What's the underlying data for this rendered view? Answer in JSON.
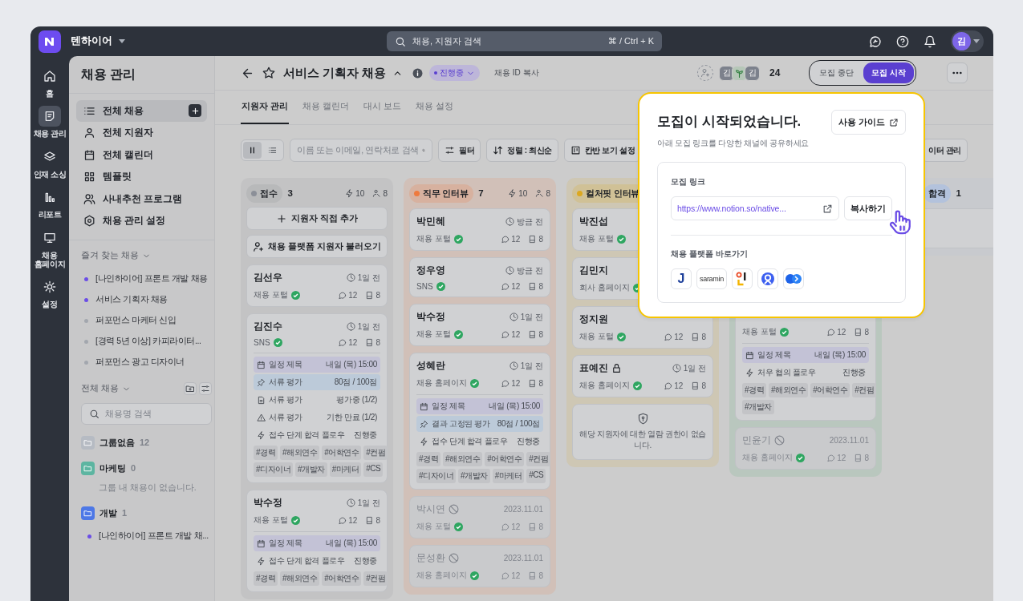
{
  "topbar": {
    "workspace": "텐하이어",
    "search": {
      "placeholder": "채용, 지원자 검색",
      "shortcut": "⌘ / Ctrl + K"
    },
    "avatar": "김"
  },
  "rail": [
    {
      "kind": "home",
      "label": "홈",
      "selected": false
    },
    {
      "kind": "recruit",
      "label": "채용 관리",
      "selected": true
    },
    {
      "kind": "layers",
      "label": "인재 소싱",
      "selected": false
    },
    {
      "kind": "report",
      "label": "리포트",
      "selected": false
    },
    {
      "kind": "monitor",
      "label": "채용 홈페이지",
      "selected": false
    },
    {
      "kind": "gear",
      "label": "설정",
      "selected": false
    }
  ],
  "sidebar": {
    "title": "채용 관리",
    "nav": [
      {
        "kind": "list",
        "label": "전체 채용",
        "selected": true,
        "add": true
      },
      {
        "kind": "user",
        "label": "전체 지원자",
        "selected": false,
        "add": false
      },
      {
        "kind": "calendar",
        "label": "전체 캘린더",
        "selected": false,
        "add": false
      },
      {
        "kind": "grid",
        "label": "템플릿",
        "selected": false,
        "add": false
      },
      {
        "kind": "users",
        "label": "사내추천 프로그램",
        "selected": false,
        "add": false
      },
      {
        "kind": "hexagon",
        "label": "채용 관리 설정",
        "selected": false,
        "add": false
      }
    ],
    "favorites": {
      "title": "즐겨 찾는 채용",
      "items": [
        {
          "label": "[나인하이어] 프론트 개발 채용",
          "color": "#6b4ee6"
        },
        {
          "label": "서비스 기획자 채용",
          "color": "#6b4ee6"
        },
        {
          "label": "퍼포먼스 마케터 신입",
          "color": "#a3a7ae"
        },
        {
          "label": "[경력 5년 이상] 카피라이터...",
          "color": "#a3a7ae"
        },
        {
          "label": "퍼포먼스 광고 디자이너",
          "color": "#a3a7ae"
        }
      ]
    },
    "all": {
      "title": "전체 채용",
      "search_placeholder": "채용명 검색",
      "groups": [
        {
          "name": "그룹없음",
          "count": "12",
          "color": "#b6bbc3"
        },
        {
          "name": "마케팅",
          "count": "0",
          "color": "#5db5a1",
          "empty_text": "그룹 내 채용이 없습니다."
        },
        {
          "name": "개발",
          "count": "1",
          "color": "#4d78e6",
          "items": [
            {
              "label": "[나인하이어] 프론트 개발 채...",
              "color": "#6b4ee6"
            }
          ]
        }
      ]
    }
  },
  "header": {
    "title": "서비스 기획자 채용",
    "status": "진행중",
    "copy_id": "채용 ID 복사",
    "members": [
      {
        "kind": "initial",
        "text": "김"
      },
      {
        "kind": "leaf"
      },
      {
        "kind": "initial",
        "text": "김"
      }
    ],
    "member_count": "24",
    "toggle": [
      {
        "label": "모집 중단",
        "selected": false
      },
      {
        "label": "모집 시작",
        "selected": true
      }
    ]
  },
  "tabs": [
    {
      "label": "지원자 관리",
      "selected": true
    },
    {
      "label": "채용 캘린더",
      "selected": false
    },
    {
      "label": "대시 보드",
      "selected": false
    },
    {
      "label": "채용 설정",
      "selected": false
    }
  ],
  "toolbar": {
    "views": [
      {
        "kind": "kanban",
        "selected": true
      },
      {
        "kind": "list",
        "selected": false
      }
    ],
    "search_placeholder": "이름 또는 이메일, 연락처로 검색",
    "buttons": [
      {
        "kind": "filter",
        "label": "필터"
      },
      {
        "kind": "sort",
        "label": "정렬 : 최신순"
      },
      {
        "kind": "board",
        "label": "칸반 보기 설정"
      }
    ],
    "data_button": "이터 관리"
  },
  "board": {
    "columns": [
      {
        "label": "접수",
        "color": "#8b8f98",
        "covered": false,
        "count": "3",
        "flows": "10",
        "people": "8",
        "actions": [
          {
            "kind": "add",
            "label": "지원자 직접 추가"
          },
          {
            "kind": "import",
            "label": "채용 플랫폼 지원자 불러오기"
          }
        ],
        "cards": [
          {
            "kind": "normal",
            "name": "김선우",
            "time": "1일 전",
            "source": "채용 포털",
            "verified": true,
            "comments": "12",
            "docs": "8"
          },
          {
            "kind": "normal",
            "name": "김진수",
            "time": "1일 전",
            "source": "SNS",
            "verified": true,
            "comments": "12",
            "docs": "8",
            "rows": [
              {
                "kind": "schedule",
                "label": "일정 제목",
                "value": "내일 (목) 15:00"
              },
              {
                "kind": "score",
                "label": "서류 평가",
                "value": "80점 / 100점"
              },
              {
                "kind": "doc",
                "label": "서류 평가",
                "value": "평가중 (1/2)"
              },
              {
                "kind": "warning",
                "label": "서류 평가",
                "value": "기한 만료 (1/2)"
              },
              {
                "kind": "flow",
                "label": "접수 단계 합격 플로우",
                "value": "진행중"
              }
            ],
            "tags": [
              "#경력",
              "#해외연수",
              "#어학연수",
              "#컨펌",
              "#디자이너",
              "#개발자",
              "#마케터",
              "#CS"
            ]
          },
          {
            "kind": "normal",
            "name": "박수정",
            "time": "1일 전",
            "source": "채용 포털",
            "verified": true,
            "comments": "12",
            "docs": "8",
            "rows": [
              {
                "kind": "schedule",
                "label": "일정 제목",
                "value": "내일 (목) 15:00"
              },
              {
                "kind": "flow",
                "label": "접수 단계 합격 플로우",
                "value": "진행중"
              }
            ],
            "tags": [
              "#경력",
              "#해외연수",
              "#어학연수",
              "#컨펌"
            ]
          }
        ]
      },
      {
        "label": "직무 인터뷰",
        "color": "#ee7a3e",
        "covered": false,
        "count": "7",
        "flows": "10",
        "people": "8",
        "cards": [
          {
            "kind": "normal",
            "name": "박민혜",
            "time": "방금 전",
            "source": "채용 포털",
            "verified": true,
            "comments": "12",
            "docs": "8"
          },
          {
            "kind": "normal",
            "name": "정우영",
            "time": "방금 전",
            "source": "SNS",
            "verified": true,
            "comments": "12",
            "docs": "8"
          },
          {
            "kind": "normal",
            "name": "박수정",
            "time": "1일 전",
            "source": "채용 포털",
            "verified": true,
            "comments": "12",
            "docs": "8"
          },
          {
            "kind": "normal",
            "name": "성혜란",
            "time": "1일 전",
            "source": "채용 홈페이지",
            "verified": true,
            "comments": "12",
            "docs": "8",
            "rows": [
              {
                "kind": "schedule",
                "label": "일정 제목",
                "value": "내일 (목) 15:00"
              },
              {
                "kind": "score",
                "label": "결과 고정된 평가",
                "value": "80점 / 100점"
              },
              {
                "kind": "flow",
                "label": "접수 단계 합격 플로우",
                "value": "진행중"
              }
            ],
            "tags": [
              "#경력",
              "#해외연수",
              "#어학연수",
              "#컨펌",
              "#디자이너",
              "#개발자",
              "#마케터",
              "#CS"
            ]
          },
          {
            "kind": "disabled",
            "name": "박시연",
            "date": "2023.11.01",
            "source": "채용 포털",
            "verified": true,
            "comments": "12",
            "docs": "8"
          },
          {
            "kind": "disabled",
            "name": "문성환",
            "date": "2023.11.01",
            "source": "채용 홈페이지",
            "verified": true,
            "comments": "12",
            "docs": "8"
          }
        ]
      },
      {
        "label": "컬처핏 인터뷰",
        "color": "#dca820",
        "covered": false,
        "cards": [
          {
            "kind": "normal",
            "name": "박진섭",
            "source": "채용 포털",
            "verified": true
          },
          {
            "kind": "normal",
            "name": "김민지",
            "source": "회사 홈페이지",
            "verified": true
          },
          {
            "kind": "normal",
            "name": "정지원",
            "source": "채용 포털",
            "verified": true,
            "comments": "12",
            "docs": "8"
          },
          {
            "kind": "locked",
            "name": "표예진",
            "time": "1일 전",
            "source": "채용 홈페이지",
            "verified": true,
            "comments": "12",
            "docs": "8"
          },
          {
            "kind": "notice",
            "text": "해당 지원자에 대한 열람 권한이 없습니다."
          }
        ]
      },
      {
        "color": "#45ad6c",
        "cards": [
          {
            "kind": "blank"
          },
          {
            "kind": "blank"
          },
          {
            "kind": "normal",
            "source": "채용 포털",
            "verified": true,
            "comments": "12",
            "docs": "8",
            "rows": [
              {
                "kind": "schedule",
                "label": "일정 제목",
                "value": "내일 (목) 15:00"
              },
              {
                "kind": "flow",
                "label": "처우 협의 플로우",
                "value": "진행중"
              }
            ],
            "tags": [
              "#경력",
              "#해외연수",
              "#어학연수",
              "#컨펌",
              "#개발자"
            ]
          },
          {
            "kind": "disabled",
            "name": "민윤기",
            "date": "2023.11.01",
            "source": "채용 홈페이지",
            "verified": true,
            "comments": "12",
            "docs": "8"
          }
        ]
      },
      {
        "label": "합격",
        "color": "#b3c2dc",
        "count": "1",
        "covered": true,
        "cards": [
          {
            "kind": "blank"
          }
        ]
      }
    ]
  },
  "popup": {
    "title": "모집이 시작되었습니다.",
    "subtitle": "아래 모집 링크를 다양한 채널에 공유하세요",
    "guide": "사용 가이드",
    "link_label": "모집 링크",
    "link": "https://www.notion.so/native...",
    "copy": "복사하기",
    "platform_label": "채용 플랫폼 바로가기",
    "platforms": [
      {
        "kind": "letter",
        "text": "J"
      },
      {
        "kind": "wordmark",
        "text": "saramin"
      },
      {
        "kind": "bars"
      },
      {
        "kind": "ring"
      },
      {
        "kind": "dots"
      }
    ]
  }
}
